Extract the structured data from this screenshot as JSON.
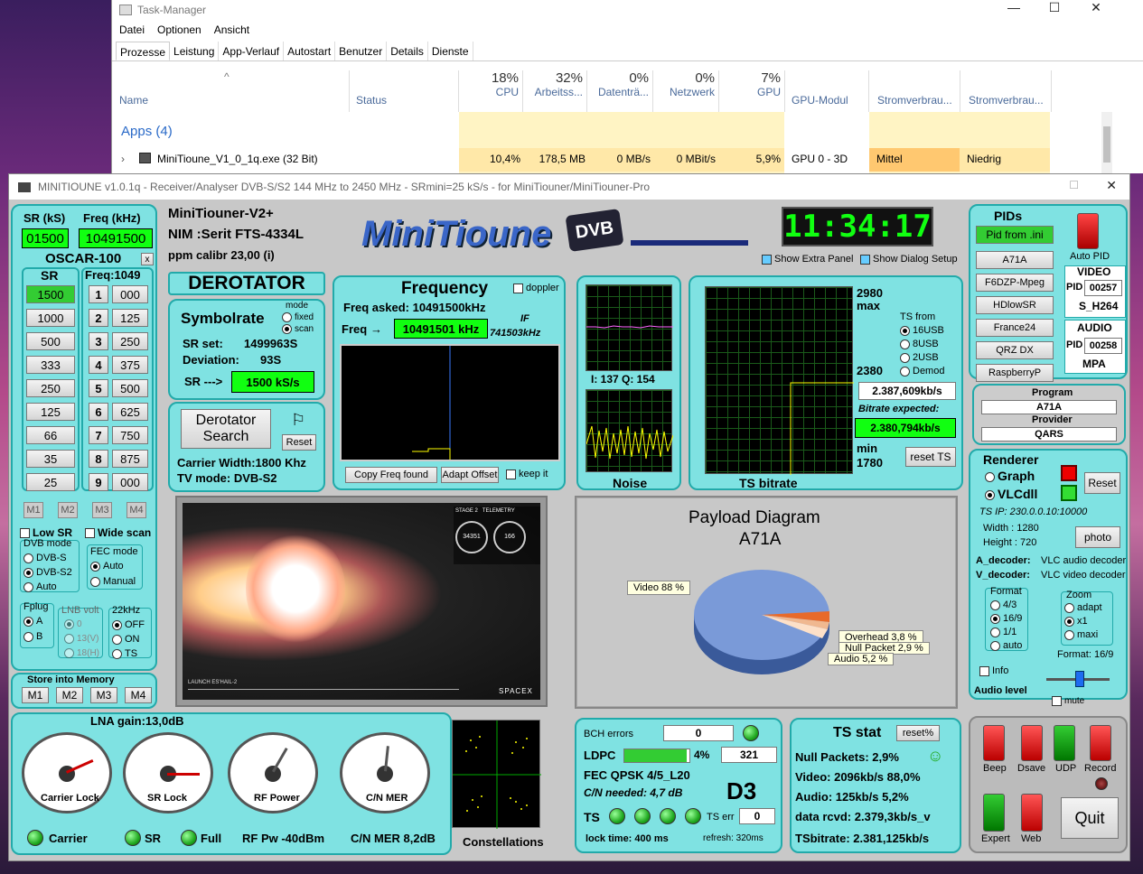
{
  "taskmgr": {
    "title": "Task-Manager",
    "menu": [
      "Datei",
      "Optionen",
      "Ansicht"
    ],
    "tabs": [
      "Prozesse",
      "Leistung",
      "App-Verlauf",
      "Autostart",
      "Benutzer",
      "Details",
      "Dienste"
    ],
    "cols": {
      "name": "Name",
      "status": "Status",
      "cpu_pct": "18%",
      "cpu": "CPU",
      "mem_pct": "32%",
      "mem": "Arbeitss...",
      "disk_pct": "0%",
      "disk": "Datenträ...",
      "net_pct": "0%",
      "net": "Netzwerk",
      "gpu_pct": "7%",
      "gpu": "GPU",
      "gpumod": "GPU-Modul",
      "power": "Stromverbrau...",
      "power2": "Stromverbrau..."
    },
    "group": "Apps (4)",
    "row": {
      "name": "MiniTioune_V1_0_1q.exe (32 Bit)",
      "cpu": "10,4%",
      "mem": "178,5 MB",
      "disk": "0 MB/s",
      "net": "0 MBit/s",
      "gpu": "5,9%",
      "gpumod": "GPU 0 - 3D",
      "power": "Mittel",
      "power2": "Niedrig"
    },
    "win_min": "—",
    "win_max": "☐",
    "win_close": "✕"
  },
  "app": {
    "title": "MINITIOUNE v1.0.1q - Receiver/Analyser DVB-S/S2 144 MHz to 2450 MHz - SRmini=25 kS/s - for MiniTiouner/MiniTiouner-Pro",
    "left": {
      "sr_label": "SR (kS)",
      "freq_label": "Freq (kHz)",
      "sr_value": "01500",
      "freq_value": "10491500",
      "sat": "OSCAR-100",
      "x": "x",
      "sr_head": "SR",
      "freq_head": "Freq:1049",
      "sr_buttons": [
        "1500",
        "1000",
        "500",
        "333",
        "250",
        "125",
        "66",
        "35",
        "25"
      ],
      "freq_nums": [
        "1",
        "2",
        "3",
        "4",
        "5",
        "6",
        "7",
        "8",
        "9"
      ],
      "freq_vals": [
        "000",
        "125",
        "250",
        "375",
        "500",
        "625",
        "750",
        "875",
        "000"
      ],
      "mem": [
        "M1",
        "M2",
        "M3",
        "M4"
      ],
      "low_sr": "Low SR",
      "wide": "Wide scan",
      "dvb_title": "DVB mode",
      "dvb": [
        "DVB-S",
        "DVB-S2",
        "Auto"
      ],
      "fec_title": "FEC mode",
      "fec": [
        "Auto",
        "Manual"
      ],
      "fplug_title": "Fplug",
      "fplug": [
        "A",
        "B"
      ],
      "lnb_title": "LNB volt",
      "lnb": [
        "0",
        "13(V)",
        "18(H)"
      ],
      "khz_title": "22kHz",
      "khz": [
        "OFF",
        "ON",
        "TS"
      ],
      "store": "Store into Memory"
    },
    "head": {
      "line1": "MiniTiouner-V2+",
      "nim": "NIM :Serit FTS-4334L",
      "ppm": "ppm calibr  23,00 (i)",
      "clock": "11:34:17",
      "extra": "Show Extra Panel",
      "dialog": "Show Dialog Setup",
      "logo": "MiniTioune",
      "dvb": "DVB"
    },
    "derot": {
      "title": "DEROTATOR",
      "symb": "Symbolrate",
      "mode": "mode",
      "fixed": "fixed",
      "scan": "scan",
      "srset_l": "SR set:",
      "srset": "1499963S",
      "dev_l": "Deviation:",
      "dev": "93S",
      "sr_l": "SR --->",
      "sr": "1500 kS/s",
      "search": "Derotator Search",
      "reset": "Reset",
      "cw": "Carrier Width:1800 Khz",
      "tv": "TV mode: DVB-S2"
    },
    "freq": {
      "title": "Frequency",
      "doppler": "doppler",
      "asked": "Freq asked: 10491500kHz",
      "freq_l": "Freq",
      "freq": "10491501 kHz",
      "if_l": "IF",
      "if": "741503kHz",
      "copy": "Copy Freq found",
      "adapt": "Adapt Offset",
      "keep": "keep it"
    },
    "noise": {
      "iq": "I:  137  Q: 154",
      "label": "Noise"
    },
    "ts": {
      "max_v": "2980",
      "max": "max",
      "mid": "2380",
      "min": "min",
      "min_v": "1780",
      "from": "TS from",
      "opts": [
        "16USB",
        "8USB",
        "2USB",
        "Demod"
      ],
      "rate": "2.387,609kb/s",
      "exp_l": "Bitrate expected:",
      "exp": "2.380,794kb/s",
      "reset": "reset TS",
      "label": "TS bitrate"
    },
    "pids": {
      "title": "PIDs",
      "ini": "Pid from .ini",
      "auto": "Auto PID",
      "list": [
        "A71A",
        "F6DZP-Mpeg",
        "HDlowSR",
        "France24",
        "QRZ DX",
        "RaspberryP"
      ],
      "video": "VIDEO",
      "pid_l": "PID",
      "vpid": "00257",
      "vcodec": "S_H264",
      "audio": "AUDIO",
      "apid": "00258",
      "acodec": "MPA"
    },
    "prog": {
      "program_l": "Program",
      "program": "A71A",
      "provider_l": "Provider",
      "provider": "QARS"
    },
    "render": {
      "title": "Renderer",
      "graph": "Graph",
      "vlc": "VLCdll",
      "reset": "Reset",
      "tsip": "TS IP:     230.0.0.10:10000",
      "width": "Width :  1280",
      "height": "Height :  720",
      "photo": "photo",
      "adec_l": "A_decoder:",
      "adec": "VLC audio decoder",
      "vdec_l": "V_decoder:",
      "vdec": "VLC video decoder",
      "fmt_t": "Format",
      "fmt": [
        "4/3",
        "16/9",
        "1/1",
        "auto"
      ],
      "zoom_t": "Zoom",
      "zoom": [
        "adapt",
        "x1",
        "maxi"
      ],
      "format": "Format:   16/9",
      "info": "Info",
      "level": "Audio level",
      "mute": "mute"
    },
    "video": {
      "caption": "LAUNCH ES'HAIL-2",
      "brand": "SPACEX",
      "stage": "STAGE 2",
      "tele": "TELEMETRY",
      "speed": "34351",
      "alt": "166"
    },
    "payload": {
      "title": "Payload Diagram",
      "sub": "A71A",
      "video": "Video 88 %",
      "overhead": "Overhead 3,8 %",
      "null": "Null Packet 2,9 %",
      "audio": "Audio 5,2 %"
    },
    "gauges": {
      "lna": "LNA gain:13,0dB",
      "g1": "Carrier Lock",
      "g2": "SR Lock",
      "g3": "RF Power",
      "g4": "C/N MER",
      "carrier": "Carrier",
      "sr": "SR",
      "full": "Full",
      "rfpw": "RF Pw -40dBm",
      "cnmer": "C/N MER 8,2dB",
      "const": "Constellations"
    },
    "fec": {
      "bch": "BCH errors",
      "bch_v": "0",
      "ldpc": "LDPC",
      "ldpc_p": "4%",
      "ldpc_v": "321",
      "fec": "FEC QPSK 4/5_L20",
      "cn": "C/N  needed:  4,7  dB",
      "d3": "D3",
      "ts": "TS",
      "tserr_l": "TS err",
      "tserr": "0",
      "lock": "lock time: 400 ms",
      "refresh": "refresh: 320ms"
    },
    "tsstat": {
      "title": "TS stat",
      "reset": "reset%",
      "null": "Null Packets:   2,9%",
      "video": "Video:    2096kb/s  88,0%",
      "audio": "Audio:     125kb/s   5,2%",
      "data": "data rcvd:  2.379,3kb/s_v",
      "tsbr": "TSbitrate:  2.381,125kb/s"
    },
    "buttons": {
      "beep": "Beep",
      "dsave": "Dsave",
      "udp": "UDP",
      "record": "Record",
      "expert": "Expert",
      "web": "Web",
      "quit": "Quit"
    }
  }
}
